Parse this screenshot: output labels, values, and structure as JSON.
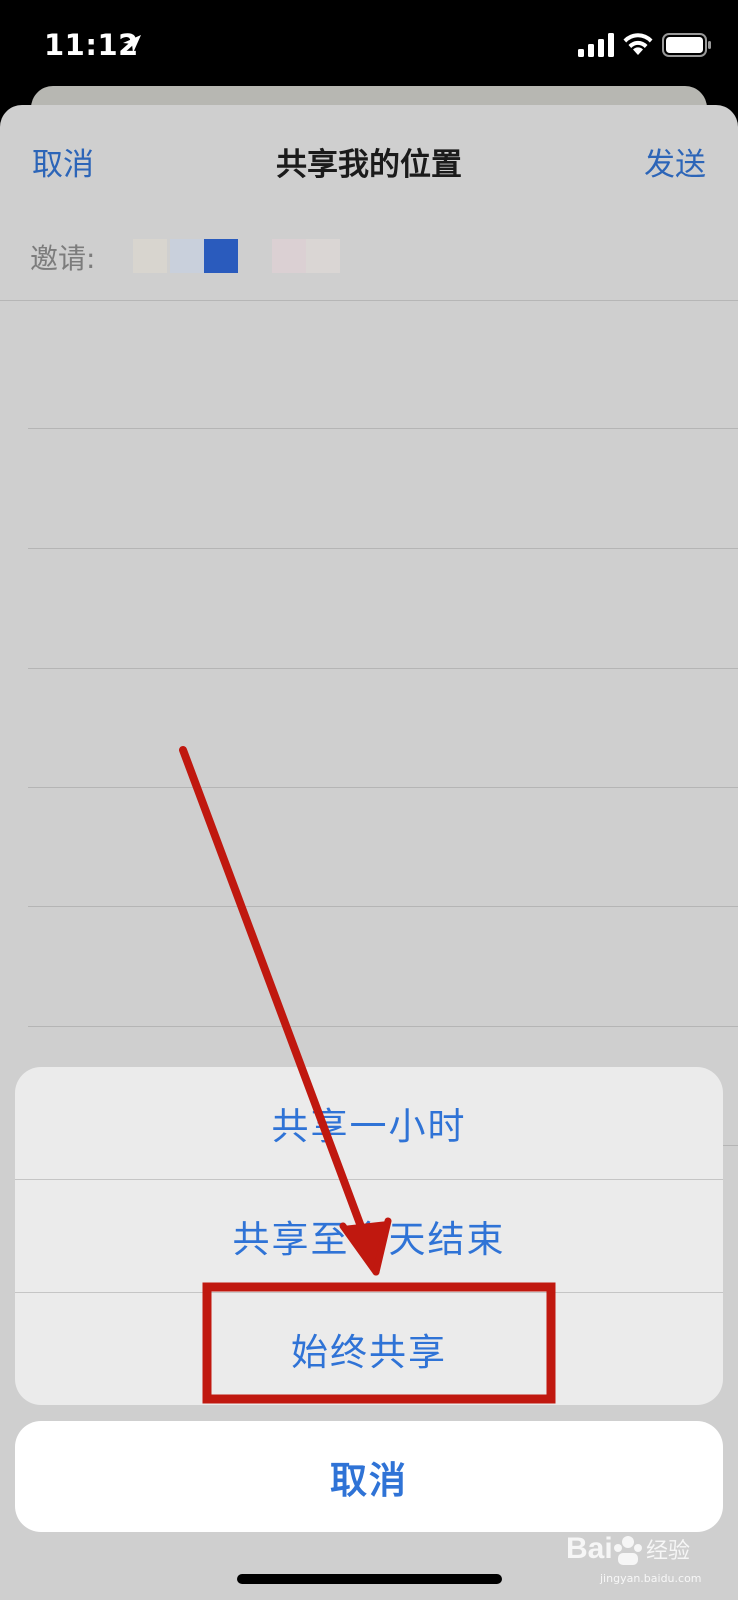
{
  "status_bar": {
    "time": "11:12",
    "icons": [
      "location-arrow-icon",
      "cellular-signal-icon",
      "wifi-icon",
      "battery-icon"
    ]
  },
  "sheet": {
    "nav": {
      "cancel_label": "取消",
      "title": "共享我的位置",
      "send_label": "发送"
    },
    "invite_label": "邀请:",
    "accent_color": "#2c65b8"
  },
  "action_sheet": {
    "options": [
      {
        "label": "共享一小时"
      },
      {
        "label": "共享至今天结束"
      },
      {
        "label": "始终共享"
      }
    ],
    "cancel_label": "取消",
    "highlighted_option": "始终共享",
    "annotation_color": "#c0180f"
  },
  "watermark": {
    "text": "jingyan.baidu.com",
    "logo_text": "Baidu 经验"
  }
}
